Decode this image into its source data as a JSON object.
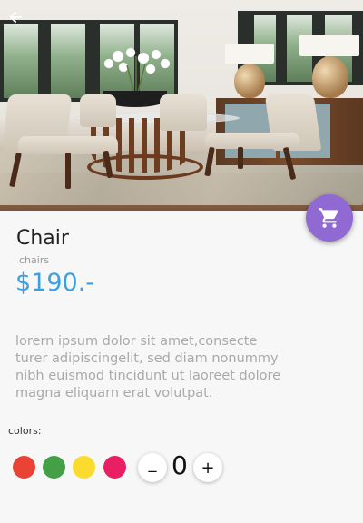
{
  "product": {
    "name": "Chair",
    "category": "chairs",
    "price": "$190.-",
    "description": "lorern ipsum dolor sit amet,consecte turer adipiscingelit, sed diam nonummy nibh euismod tincidunt ut laoreet dolore magna eliquarn erat volutpat."
  },
  "colors": {
    "label": "colors:",
    "swatches": [
      "#ea4335",
      "#43a047",
      "#fbdb2e",
      "#e91e63"
    ]
  },
  "quantity": {
    "decrement_label": "_",
    "value": "0",
    "increment_label": "+"
  },
  "icons": {
    "back": "arrow-back-icon",
    "cart": "shopping-cart-icon"
  },
  "theme": {
    "accent": "#9169d3",
    "price_color": "#3aa1e0"
  }
}
